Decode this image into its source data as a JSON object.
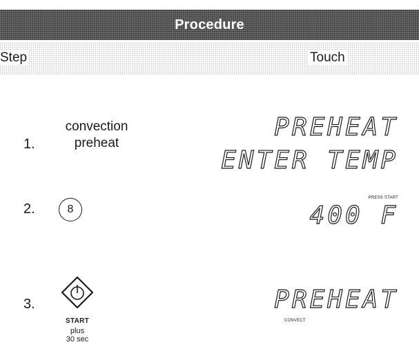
{
  "header": {
    "title": "Procedure"
  },
  "columns": {
    "step": "Step",
    "touch": "Touch"
  },
  "steps": [
    {
      "number": "1.",
      "action_line1": "convection",
      "action_line2": "preheat",
      "display_line1": "PREHEAT",
      "display_line2": "ENTER TEMP"
    },
    {
      "number": "2.",
      "key": "8",
      "display_small": "PRESS START",
      "display_line1": "400 F"
    },
    {
      "number": "3.",
      "key_label": "START",
      "plus_line1": "plus",
      "plus_line2": "30 sec",
      "display_line1": "PREHEAT",
      "display_small": "CONVECT"
    }
  ],
  "icons": {
    "start": "start-diamond-icon"
  }
}
